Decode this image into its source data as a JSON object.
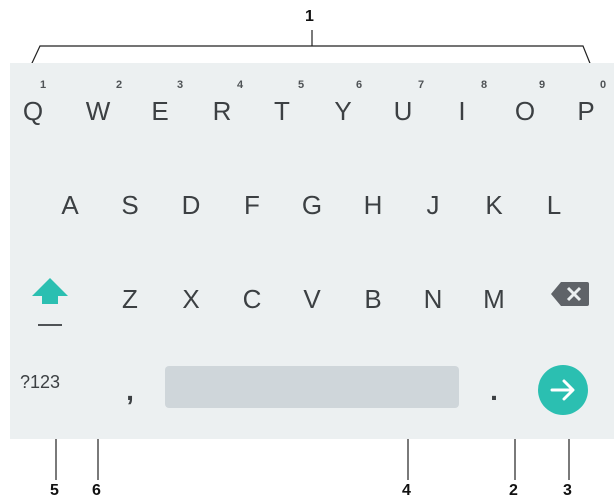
{
  "callouts": [
    "1",
    "2",
    "3",
    "4",
    "5",
    "6"
  ],
  "keyboard": {
    "row1": [
      {
        "key": "Q",
        "hint": "1"
      },
      {
        "key": "W",
        "hint": "2"
      },
      {
        "key": "E",
        "hint": "3"
      },
      {
        "key": "R",
        "hint": "4"
      },
      {
        "key": "T",
        "hint": "5"
      },
      {
        "key": "Y",
        "hint": "6"
      },
      {
        "key": "U",
        "hint": "7"
      },
      {
        "key": "I",
        "hint": "8"
      },
      {
        "key": "O",
        "hint": "9"
      },
      {
        "key": "P",
        "hint": "0"
      }
    ],
    "row2": [
      "A",
      "S",
      "D",
      "F",
      "G",
      "H",
      "J",
      "K",
      "L"
    ],
    "row3": [
      "Z",
      "X",
      "C",
      "V",
      "B",
      "N",
      "M"
    ],
    "symbols_label": "?123",
    "comma": ",",
    "period": ".",
    "icons": {
      "shift": "shift-arrow-up",
      "backspace": "backspace-x",
      "enter": "arrow-right"
    },
    "colors": {
      "background": "#ecf0f1",
      "key_text": "#3c4043",
      "shift": "#2bbfb1",
      "enter": "#2bbfb1",
      "spacebar": "#cfd6da"
    }
  }
}
